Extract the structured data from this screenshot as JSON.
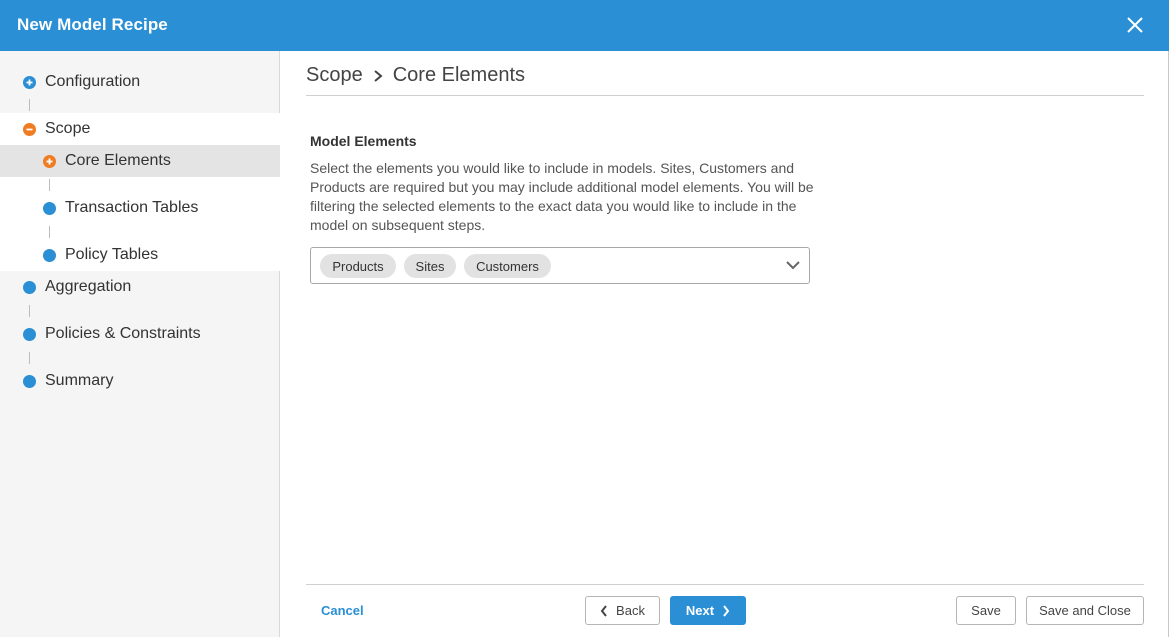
{
  "window": {
    "title": "New Model Recipe"
  },
  "sidebar": {
    "items": [
      {
        "label": "Configuration",
        "state": "plus",
        "color": "#2a8fd4"
      },
      {
        "label": "Scope",
        "state": "minus",
        "color": "#f07c22"
      },
      {
        "label": "Core Elements",
        "state": "plus",
        "color": "#f07c22",
        "active": true
      },
      {
        "label": "Transaction Tables",
        "state": "dot",
        "color": "#2a8fd4"
      },
      {
        "label": "Policy Tables",
        "state": "dot",
        "color": "#2a8fd4"
      },
      {
        "label": "Aggregation",
        "state": "dot",
        "color": "#2a8fd4"
      },
      {
        "label": "Policies & Constraints",
        "state": "dot",
        "color": "#2a8fd4"
      },
      {
        "label": "Summary",
        "state": "dot",
        "color": "#2a8fd4"
      }
    ]
  },
  "main": {
    "breadcrumb": {
      "parent": "Scope",
      "current": "Core Elements"
    },
    "section_label": "Model Elements",
    "description": "Select the elements you would like to include in models. Sites, Customers and Products are required but you may include additional model elements. You will be filtering the selected elements to the exact data you would like to include in the model on subsequent steps.",
    "selected_elements": [
      "Products",
      "Sites",
      "Customers"
    ]
  },
  "footer": {
    "cancel_label": "Cancel",
    "back_label": "Back",
    "next_label": "Next",
    "save_label": "Save",
    "save_close_label": "Save and Close"
  },
  "colors": {
    "accent": "#2a8fd4",
    "in_progress": "#f07c22"
  }
}
